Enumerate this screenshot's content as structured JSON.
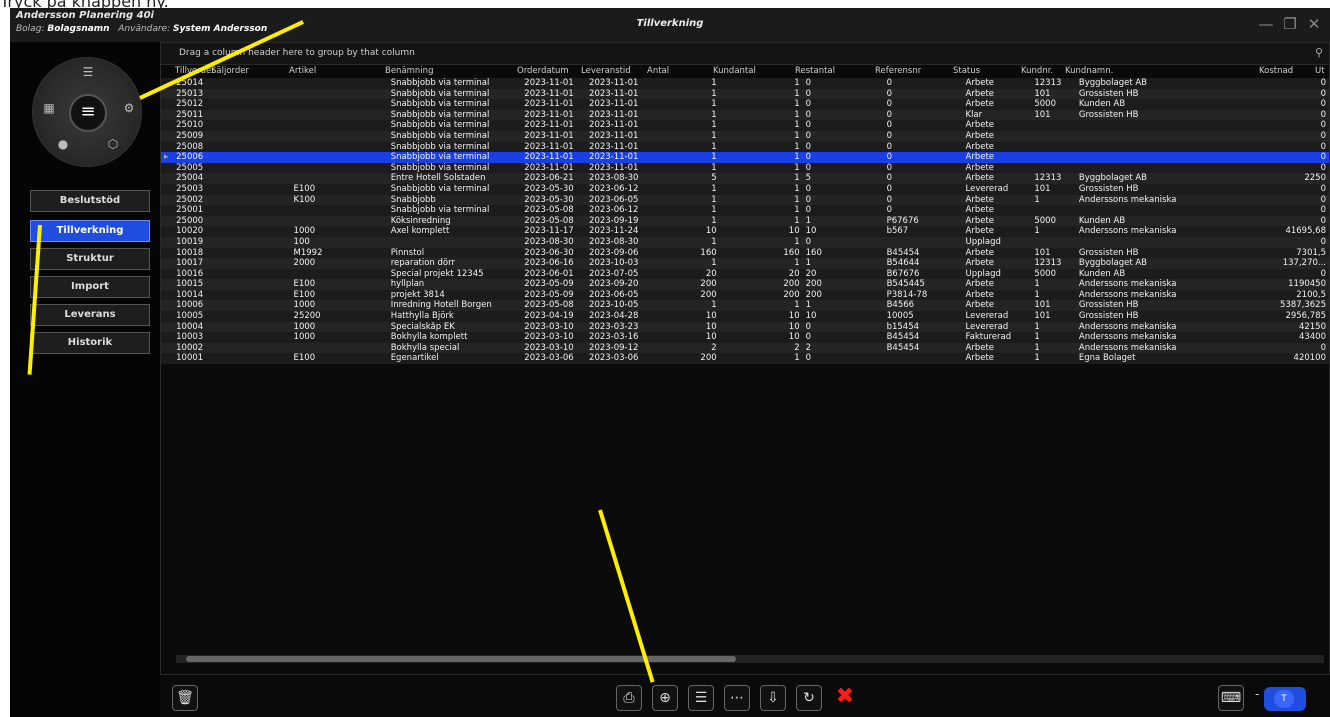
{
  "caption": "Tryck på knappen ny.",
  "app": {
    "name": "Andersson Planering 40i",
    "company_label": "Bolag:",
    "company": "Bolagsnamn",
    "user_label": "Användare:",
    "user": "System Andersson",
    "title": "Tillverkning"
  },
  "window_controls": {
    "minimize": "—",
    "maximize": "❐",
    "close": "✕"
  },
  "nav": {
    "items": [
      {
        "label": "Beslutstöd",
        "active": false
      },
      {
        "label": "Tillverkning",
        "active": true
      },
      {
        "label": "Struktur",
        "active": false
      },
      {
        "label": "Import",
        "active": false
      },
      {
        "label": "Leverans",
        "active": false
      },
      {
        "label": "Historik",
        "active": false
      }
    ]
  },
  "grid": {
    "group_hint": "Drag a column header here to group by that column",
    "columns": [
      "Tillvorder",
      "Säljorder",
      "Artikel",
      "Benämning",
      "Orderdatum",
      "Leveranstid",
      "Antal",
      "Kundantal",
      "Restantal",
      "Referensnr",
      "Status",
      "Kundnr.",
      "Kundnamn.",
      "Kostnad",
      "Ut"
    ],
    "selected_row": 7,
    "rows": [
      [
        "25014",
        "",
        "",
        "Snabbjobb via terminal",
        "2023-11-01",
        "2023-11-01",
        "1",
        "1",
        "0",
        "0",
        "Arbete",
        "12313",
        "Byggbolaget AB",
        "0"
      ],
      [
        "25013",
        "",
        "",
        "Snabbjobb via terminal",
        "2023-11-01",
        "2023-11-01",
        "1",
        "1",
        "0",
        "0",
        "Arbete",
        "101",
        "Grossisten HB",
        "0"
      ],
      [
        "25012",
        "",
        "",
        "Snabbjobb via terminal",
        "2023-11-01",
        "2023-11-01",
        "1",
        "1",
        "0",
        "0",
        "Arbete",
        "5000",
        "Kunden AB",
        "0"
      ],
      [
        "25011",
        "",
        "",
        "Snabbjobb via terminal",
        "2023-11-01",
        "2023-11-01",
        "1",
        "1",
        "0",
        "0",
        "Klar",
        "101",
        "Grossisten HB",
        "0"
      ],
      [
        "25010",
        "",
        "",
        "Snabbjobb via terminal",
        "2023-11-01",
        "2023-11-01",
        "1",
        "1",
        "0",
        "0",
        "Arbete",
        "",
        "",
        "0"
      ],
      [
        "25009",
        "",
        "",
        "Snabbjobb via terminal",
        "2023-11-01",
        "2023-11-01",
        "1",
        "1",
        "0",
        "0",
        "Arbete",
        "",
        "",
        "0"
      ],
      [
        "25008",
        "",
        "",
        "Snabbjobb via terminal",
        "2023-11-01",
        "2023-11-01",
        "1",
        "1",
        "0",
        "0",
        "Arbete",
        "",
        "",
        "0"
      ],
      [
        "25006",
        "",
        "",
        "Snabbjobb via terminal",
        "2023-11-01",
        "2023-11-01",
        "1",
        "1",
        "0",
        "0",
        "Arbete",
        "",
        "",
        "0"
      ],
      [
        "25005",
        "",
        "",
        "Snabbjobb via terminal",
        "2023-11-01",
        "2023-11-01",
        "1",
        "1",
        "0",
        "0",
        "Arbete",
        "",
        "",
        "0"
      ],
      [
        "25004",
        "",
        "",
        "Entre Hotell Solstaden",
        "2023-06-21",
        "2023-08-30",
        "5",
        "1",
        "5",
        "0",
        "Arbete",
        "12313",
        "Byggbolaget AB",
        "2250"
      ],
      [
        "25003",
        "",
        "E100",
        "Snabbjobb via terminal",
        "2023-05-30",
        "2023-06-12",
        "1",
        "1",
        "0",
        "0",
        "Levererad",
        "101",
        "Grossisten HB",
        "0"
      ],
      [
        "25002",
        "",
        "K100",
        "Snabbjobb",
        "2023-05-30",
        "2023-06-05",
        "1",
        "1",
        "0",
        "0",
        "Arbete",
        "1",
        "Anderssons mekaniska",
        "0"
      ],
      [
        "25001",
        "",
        "",
        "Snabbjobb via terminal",
        "2023-05-08",
        "2023-06-12",
        "1",
        "1",
        "0",
        "0",
        "Arbete",
        "",
        "",
        "0"
      ],
      [
        "25000",
        "",
        "",
        "Köksinredning",
        "2023-05-08",
        "2023-09-19",
        "1",
        "1",
        "1",
        "P67676",
        "Arbete",
        "5000",
        "Kunden AB",
        "0"
      ],
      [
        "10020",
        "",
        "1000",
        "Axel komplett",
        "2023-11-17",
        "2023-11-24",
        "10",
        "10",
        "10",
        "b567",
        "Arbete",
        "1",
        "Anderssons mekaniska",
        "41695,68"
      ],
      [
        "10019",
        "",
        "100",
        "",
        "2023-08-30",
        "2023-08-30",
        "1",
        "1",
        "0",
        "",
        "Upplagd",
        "",
        "",
        "0"
      ],
      [
        "10018",
        "",
        "M1992",
        "Pinnstol",
        "2023-06-30",
        "2023-09-06",
        "160",
        "160",
        "160",
        "B45454",
        "Arbete",
        "101",
        "Grossisten HB",
        "7301,5"
      ],
      [
        "10017",
        "",
        "2000",
        "reparation dörr",
        "2023-06-16",
        "2023-10-03",
        "1",
        "1",
        "1",
        "B54644",
        "Arbete",
        "12313",
        "Byggbolaget AB",
        "137,270..."
      ],
      [
        "10016",
        "",
        "",
        "Special projekt 12345",
        "2023-06-01",
        "2023-07-05",
        "20",
        "20",
        "20",
        "B67676",
        "Upplagd",
        "5000",
        "Kunden AB",
        "0"
      ],
      [
        "10015",
        "",
        "E100",
        "hyllplan",
        "2023-05-09",
        "2023-09-20",
        "200",
        "200",
        "200",
        "B545445",
        "Arbete",
        "1",
        "Anderssons mekaniska",
        "1190450"
      ],
      [
        "10014",
        "",
        "E100",
        "projekt 3814",
        "2023-05-09",
        "2023-06-05",
        "200",
        "200",
        "200",
        "P3814-78",
        "Arbete",
        "1",
        "Anderssons mekaniska",
        "2100,5"
      ],
      [
        "10006",
        "",
        "1000",
        "Inredning Hotell Borgen",
        "2023-05-08",
        "2023-10-05",
        "1",
        "1",
        "1",
        "B4566",
        "Arbete",
        "101",
        "Grossisten HB",
        "5387,3625"
      ],
      [
        "10005",
        "",
        "25200",
        "Hatthylla Björk",
        "2023-04-19",
        "2023-04-28",
        "10",
        "10",
        "10",
        "10005",
        "Levererad",
        "101",
        "Grossisten HB",
        "2956,785"
      ],
      [
        "10004",
        "",
        "1000",
        "Specialskåp EK",
        "2023-03-10",
        "2023-03-23",
        "10",
        "10",
        "0",
        "b15454",
        "Levererad",
        "1",
        "Anderssons mekaniska",
        "42150"
      ],
      [
        "10003",
        "",
        "1000",
        "Bokhylla komplett",
        "2023-03-10",
        "2023-03-16",
        "10",
        "10",
        "0",
        "B45454",
        "Fakturerad",
        "1",
        "Anderssons mekaniska",
        "43400"
      ],
      [
        "10002",
        "",
        "",
        "Bokhylla special",
        "2023-03-10",
        "2023-09-12",
        "2",
        "2",
        "2",
        "B45454",
        "Arbete",
        "1",
        "Anderssons mekaniska",
        "0"
      ],
      [
        "10001",
        "",
        "E100",
        "Egenartikel",
        "2023-03-06",
        "2023-03-06",
        "200",
        "1",
        "0",
        "",
        "Arbete",
        "1",
        "Egna Bolaget",
        "420100"
      ]
    ]
  },
  "toolbar": {
    "delete_icon": "trash-icon",
    "buttons": [
      "print-icon",
      "new-document-icon",
      "document-icon",
      "more-icon",
      "import-icon",
      "refresh-icon",
      "close-x-icon"
    ],
    "slider_label": "T",
    "zoom_minus": "-"
  },
  "annotation_color": "#ffee00"
}
